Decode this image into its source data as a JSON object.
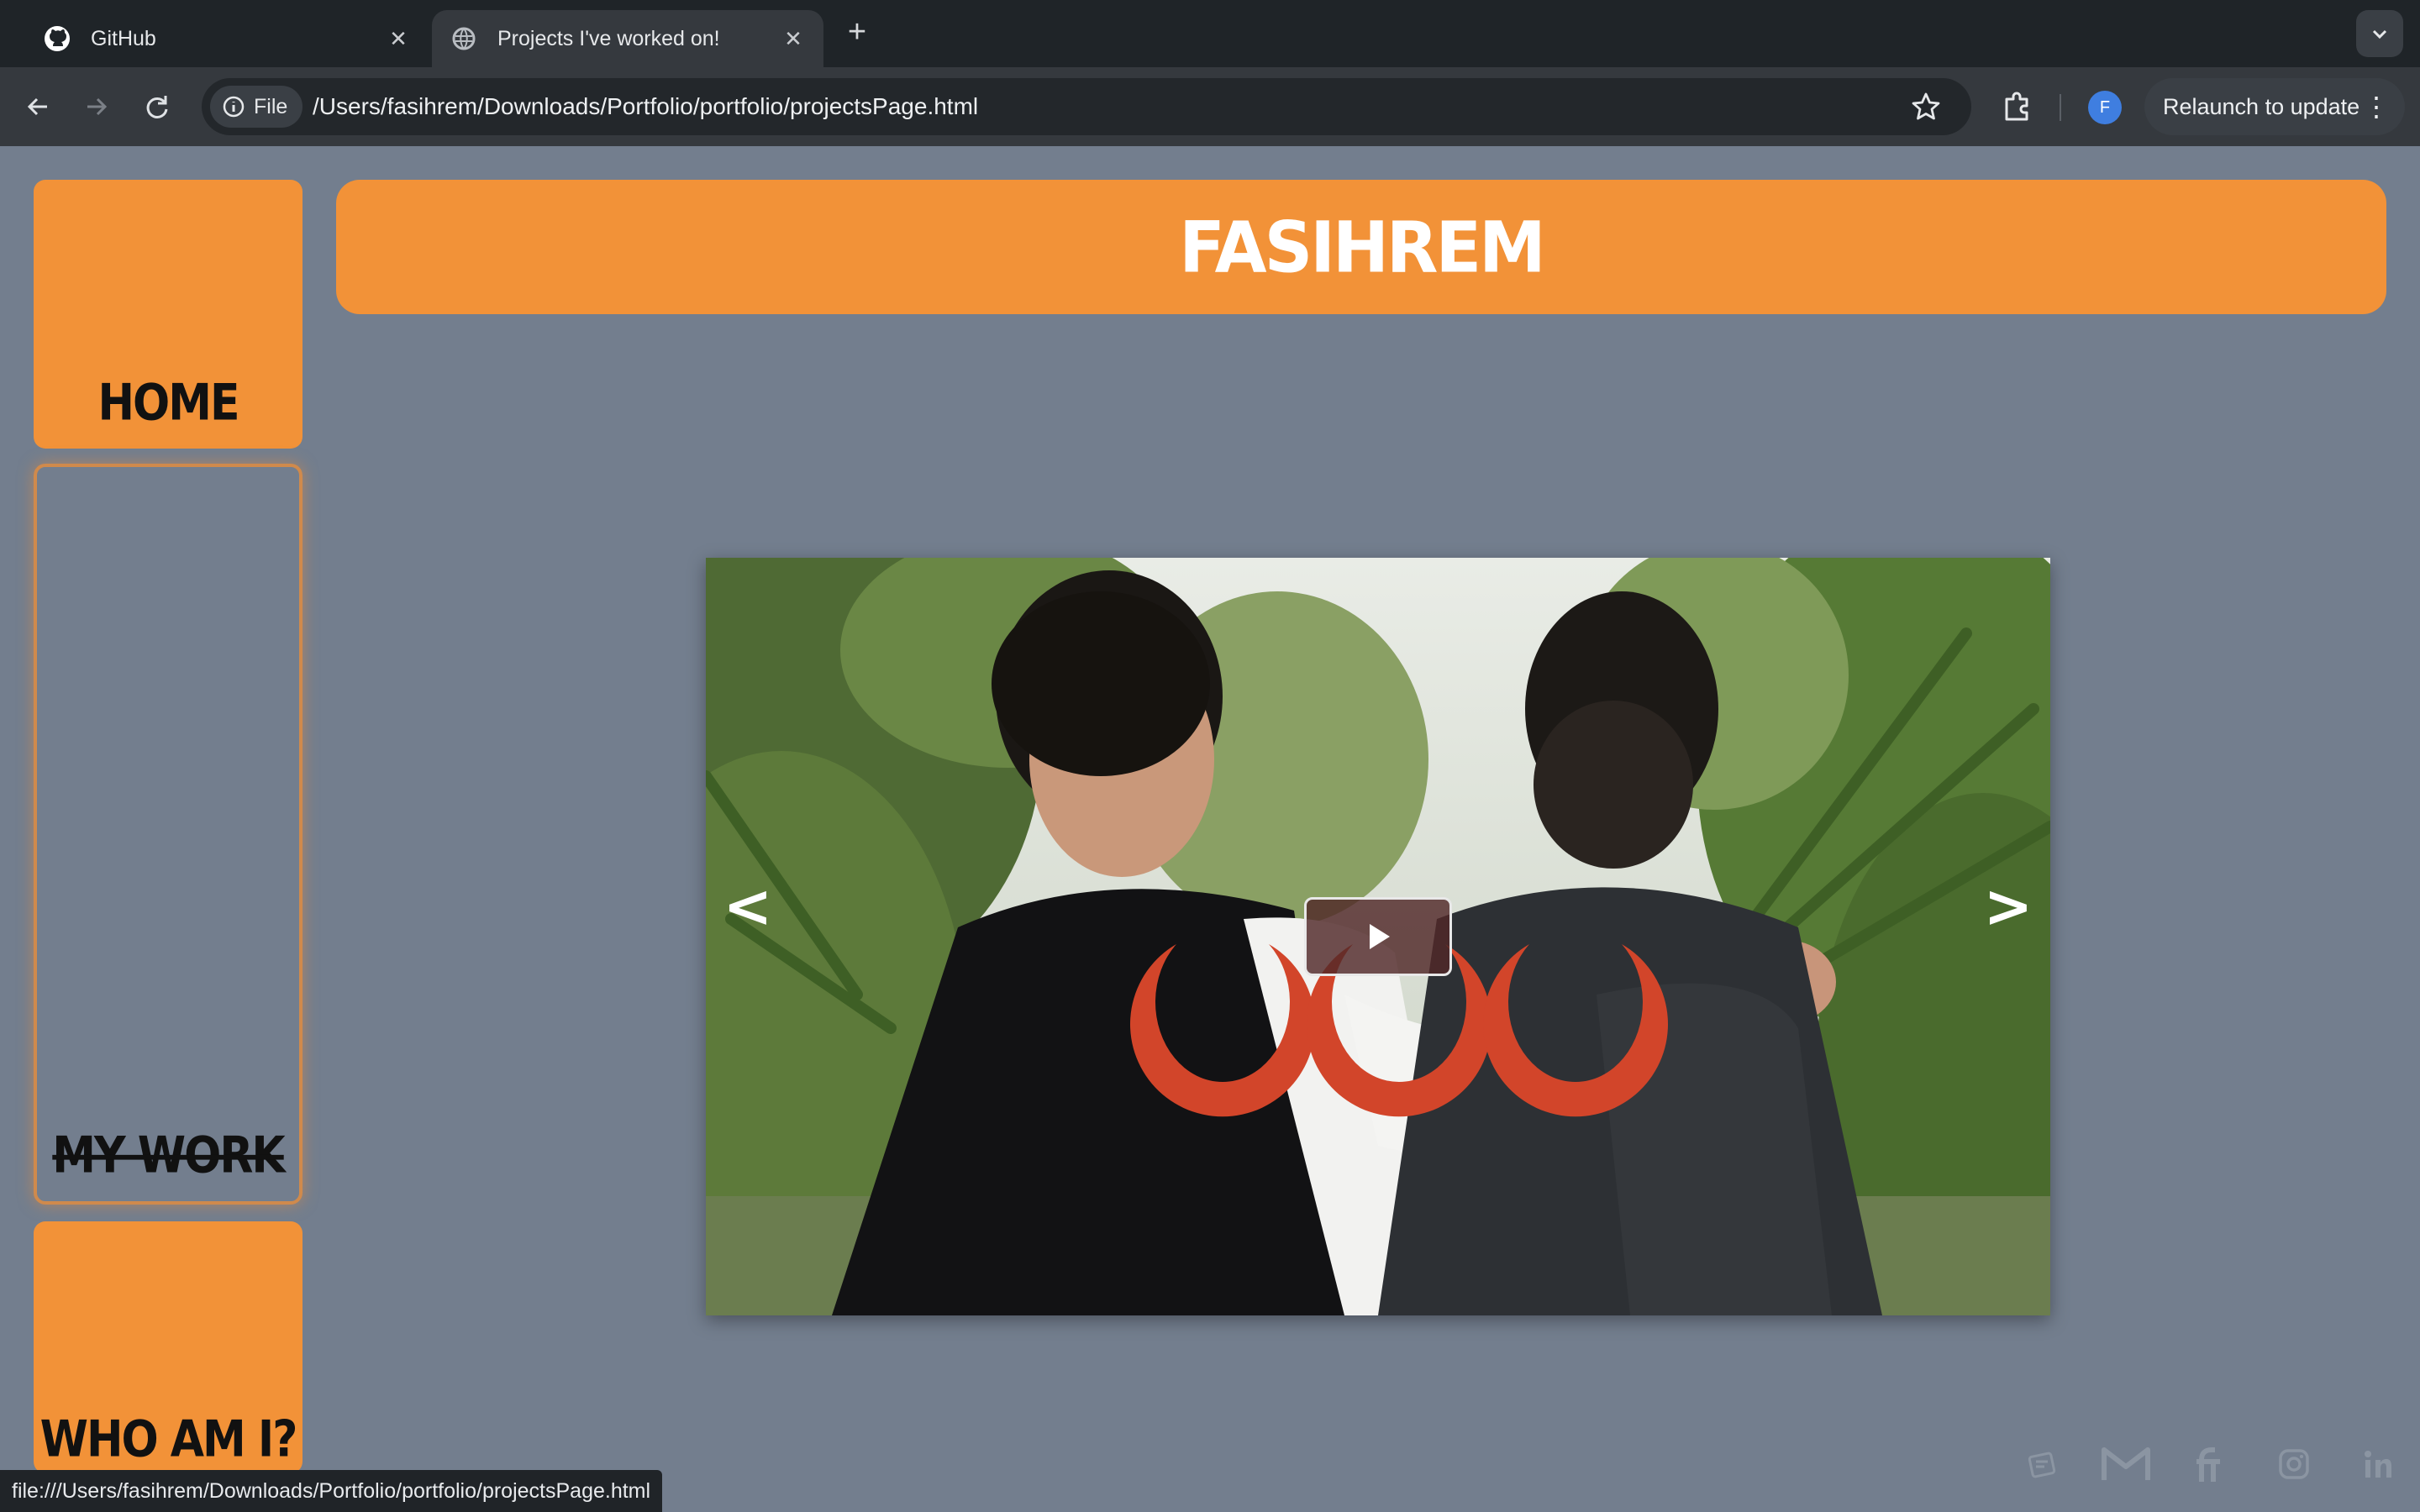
{
  "browser": {
    "tabs": [
      {
        "title": "GitHub",
        "icon": "github-icon",
        "active": false
      },
      {
        "title": "Projects I've worked on!",
        "icon": "globe-icon",
        "active": true
      }
    ],
    "chip_label": "File",
    "url": "/Users/fasihrem/Downloads/Portfolio/portfolio/projectsPage.html",
    "profile_initial": "F",
    "relaunch_label": "Relaunch to update",
    "status_url": "file:///Users/fasihrem/Downloads/Portfolio/portfolio/projectsPage.html"
  },
  "page": {
    "logo_text": "FASIHREM",
    "nav": [
      {
        "label": "HOME",
        "current": false
      },
      {
        "label": "MY WORK",
        "current": true
      },
      {
        "label": "WHO AM I?",
        "current": false
      }
    ],
    "carousel": {
      "prev_label": "<",
      "next_label": ">",
      "slide_overlay_text": "CCC"
    },
    "socials": [
      "notes-icon",
      "gmail-icon",
      "fiverr-icon",
      "instagram-icon",
      "linkedin-icon"
    ]
  },
  "colors": {
    "page_bg": "#737e8e",
    "accent": "#f29238",
    "overlay_red": "#d2452a"
  }
}
